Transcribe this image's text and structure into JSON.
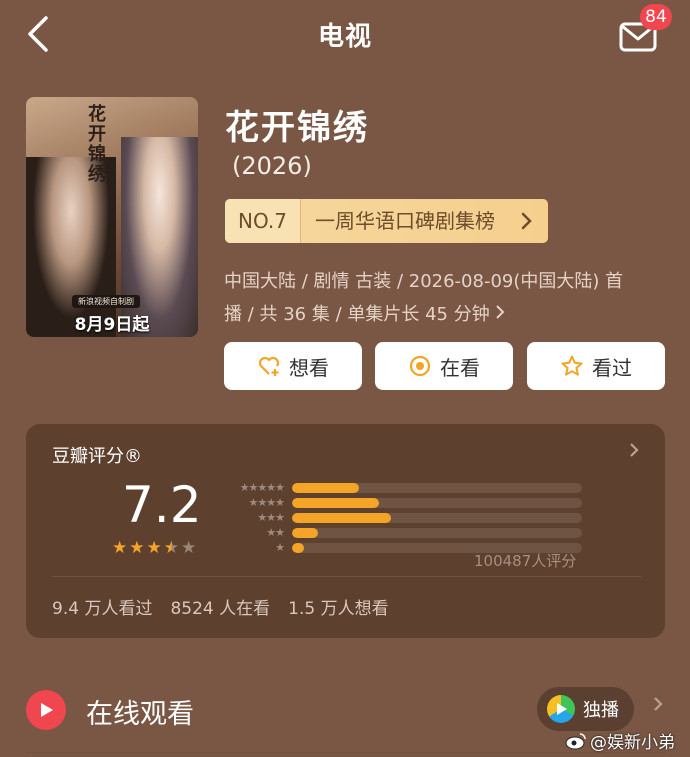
{
  "header": {
    "title": "电视",
    "mail_badge": "84"
  },
  "poster": {
    "calligraphy": "花开锦绣",
    "pill_text": "新浪视频自制剧",
    "date_text": "8月9日起"
  },
  "show": {
    "title": "花开锦绣",
    "year": "(2026)",
    "rank_no": "NO.7",
    "rank_label": "一周华语口碑剧集榜",
    "meta_line1": "中国大陆 / 剧情 古装 / 2026-08-09(中国大陆) 首",
    "meta_line2": "播 / 共 36 集 / 单集片长 45 分钟"
  },
  "actions": {
    "want": "想看",
    "watching": "在看",
    "watched": "看过"
  },
  "rating": {
    "title": "豆瓣评分®",
    "score": "7.2",
    "stars": 3.5,
    "distribution": [
      {
        "label": "★★★★★",
        "pct": 0.23
      },
      {
        "label": "★★★★",
        "pct": 0.3
      },
      {
        "label": "★★★",
        "pct": 0.34
      },
      {
        "label": "★★",
        "pct": 0.09
      },
      {
        "label": "★",
        "pct": 0.04
      }
    ],
    "count": "100487人评分",
    "stats": [
      "9.4 万人看过",
      "8524 人在看",
      "1.5 万人想看"
    ]
  },
  "online": {
    "label": "在线观看",
    "exclusive": "独播"
  },
  "watermark": "@娱新小弟",
  "colors": {
    "background": "#7a5744",
    "accent_orange": "#f4a426",
    "play_red": "#f0464f",
    "rank_gold": "#f6d8a0"
  }
}
